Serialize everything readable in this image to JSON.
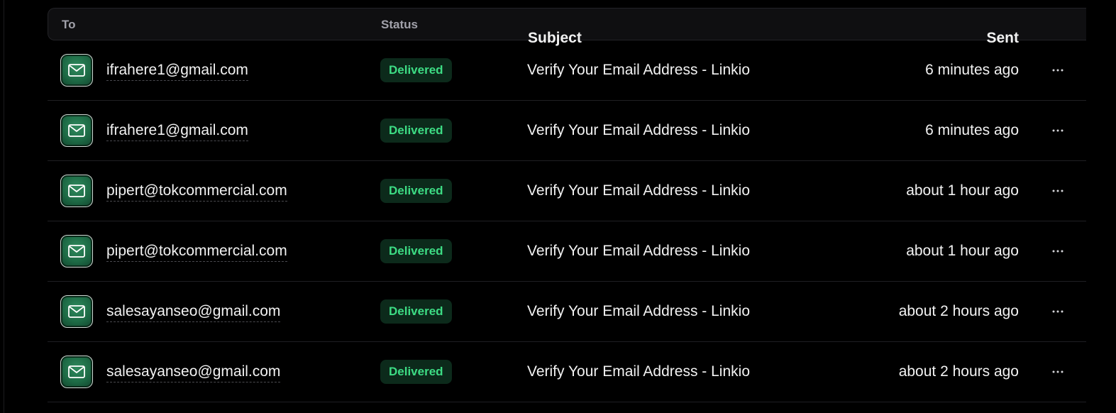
{
  "table": {
    "headers": {
      "to": "To",
      "status": "Status",
      "subject": "Subject",
      "sent": "Sent"
    },
    "rows": [
      {
        "to": "ifrahere1@gmail.com",
        "status": "Delivered",
        "subject": "Verify Your Email Address - Linkio",
        "sent": "6 minutes ago",
        "icon": "mail-icon"
      },
      {
        "to": "ifrahere1@gmail.com",
        "status": "Delivered",
        "subject": "Verify Your Email Address - Linkio",
        "sent": "6 minutes ago",
        "icon": "mail-icon"
      },
      {
        "to": "pipert@tokcommercial.com",
        "status": "Delivered",
        "subject": "Verify Your Email Address - Linkio",
        "sent": "about 1 hour ago",
        "icon": "mail-icon"
      },
      {
        "to": "pipert@tokcommercial.com",
        "status": "Delivered",
        "subject": "Verify Your Email Address - Linkio",
        "sent": "about 1 hour ago",
        "icon": "mail-icon"
      },
      {
        "to": "salesayanseo@gmail.com",
        "status": "Delivered",
        "subject": "Verify Your Email Address - Linkio",
        "sent": "about 2 hours ago",
        "icon": "mail-icon"
      },
      {
        "to": "salesayanseo@gmail.com",
        "status": "Delivered",
        "subject": "Verify Your Email Address - Linkio",
        "sent": "about 2 hours ago",
        "icon": "mail-icon"
      }
    ],
    "row_action_icon": "more-horizontal-icon"
  },
  "colors": {
    "background": "#000000",
    "status_delivered_text": "#3ddc84",
    "status_delivered_bg": "#0c2a1b",
    "avatar_green": "#1d6a45"
  }
}
